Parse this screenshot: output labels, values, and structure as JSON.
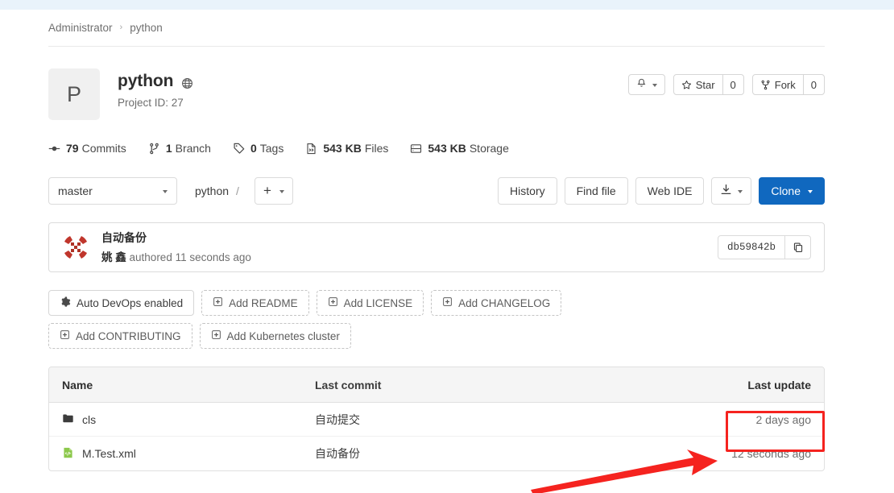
{
  "breadcrumb": {
    "items": [
      "Administrator",
      "python"
    ],
    "separator": "›"
  },
  "project": {
    "avatar_letter": "P",
    "name": "python",
    "visibility_icon": "globe-icon",
    "id_label": "Project ID: 27"
  },
  "header_actions": {
    "notification_icon": "bell-icon",
    "star_label": "Star",
    "star_count": "0",
    "fork_label": "Fork",
    "fork_count": "0"
  },
  "stats": [
    {
      "icon": "commit-icon",
      "value": "79",
      "label": "Commits"
    },
    {
      "icon": "branch-icon",
      "value": "1",
      "label": "Branch"
    },
    {
      "icon": "tag-icon",
      "value": "0",
      "label": "Tags"
    },
    {
      "icon": "file-icon",
      "value": "543 KB",
      "label": "Files"
    },
    {
      "icon": "storage-icon",
      "value": "543 KB",
      "label": "Storage"
    }
  ],
  "repo_toolbar": {
    "branch": "master",
    "path_root": "python",
    "path_separator": "/",
    "add_button": "+",
    "history_label": "History",
    "find_file_label": "Find file",
    "web_ide_label": "Web IDE",
    "download_icon": "download-icon",
    "clone_label": "Clone",
    "clone_color": "#1068bf"
  },
  "commit": {
    "title": "自动备份",
    "author": "姚 鑫",
    "authored_text": "authored 11 seconds ago",
    "hash": "db59842b",
    "copy_icon": "copy-icon"
  },
  "chips": [
    {
      "icon": "gear-icon",
      "label": "Auto DevOps enabled",
      "style": "solid"
    },
    {
      "icon": "plus-square-icon",
      "label": "Add README",
      "style": "dashed"
    },
    {
      "icon": "plus-square-icon",
      "label": "Add LICENSE",
      "style": "dashed"
    },
    {
      "icon": "plus-square-icon",
      "label": "Add CHANGELOG",
      "style": "dashed"
    },
    {
      "icon": "plus-square-icon",
      "label": "Add CONTRIBUTING",
      "style": "dashed"
    },
    {
      "icon": "plus-square-icon",
      "label": "Add Kubernetes cluster",
      "style": "dashed"
    }
  ],
  "file_table": {
    "headers": {
      "name": "Name",
      "last_commit": "Last commit",
      "last_update": "Last update"
    },
    "rows": [
      {
        "icon": "folder-icon",
        "name": "cls",
        "last_commit": "自动提交",
        "last_update": "2 days ago"
      },
      {
        "icon": "xml-file-icon",
        "name": "M.Test.xml",
        "last_commit": "自动备份",
        "last_update": "12 seconds ago"
      }
    ]
  },
  "annotations": {
    "highlight_color": "#f5231f",
    "highlight_target": "12 seconds ago",
    "arrow_direction": "up-right"
  }
}
